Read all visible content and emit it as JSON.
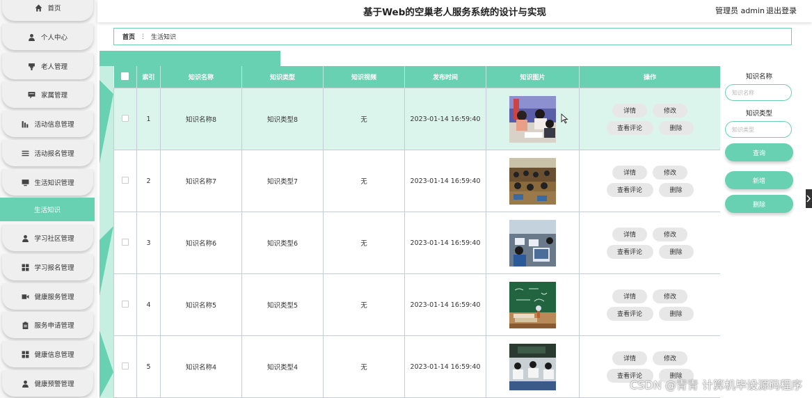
{
  "header": {
    "title": "基于Web的空巢老人服务系统的设计与实现",
    "user": "管理员 admin",
    "logout": "退出登录"
  },
  "breadcrumb": {
    "home": "首页",
    "separator": "⋮",
    "current": "生活知识"
  },
  "sidebar": {
    "items": [
      {
        "label": "首页",
        "icon": "home-icon"
      },
      {
        "label": "个人中心",
        "icon": "person-icon"
      },
      {
        "label": "老人管理",
        "icon": "elder-icon"
      },
      {
        "label": "家属管理",
        "icon": "family-icon"
      },
      {
        "label": "活动信息管理",
        "icon": "chart-icon"
      },
      {
        "label": "活动报名管理",
        "icon": "list-icon"
      },
      {
        "label": "生活知识管理",
        "icon": "monitor-icon"
      },
      {
        "label": "生活知识",
        "icon": "",
        "active": true
      },
      {
        "label": "学习社区管理",
        "icon": "person-icon"
      },
      {
        "label": "学习报名管理",
        "icon": "grid-icon"
      },
      {
        "label": "健康服务管理",
        "icon": "video-icon"
      },
      {
        "label": "服务申请管理",
        "icon": "clipboard-icon"
      },
      {
        "label": "健康信息管理",
        "icon": "grid-icon"
      },
      {
        "label": "健康预警管理",
        "icon": "person-icon"
      }
    ]
  },
  "table": {
    "headers": [
      "索引",
      "知识名称",
      "知识类型",
      "知识视频",
      "发布时间",
      "知识图片",
      "操作"
    ],
    "rows": [
      {
        "index": "1",
        "name": "知识名称8",
        "type": "知识类型8",
        "video": "无",
        "time": "2023-01-14 16:59:40",
        "image": "classroom-photo"
      },
      {
        "index": "2",
        "name": "知识名称7",
        "type": "知识类型7",
        "video": "无",
        "time": "2023-01-14 16:59:40",
        "image": "classroom-photo"
      },
      {
        "index": "3",
        "name": "知识名称6",
        "type": "知识类型6",
        "video": "无",
        "time": "2023-01-14 16:59:40",
        "image": "classroom-photo"
      },
      {
        "index": "4",
        "name": "知识名称5",
        "type": "知识类型5",
        "video": "无",
        "time": "2023-01-14 16:59:40",
        "image": "chalkboard-photo"
      },
      {
        "index": "5",
        "name": "知识名称4",
        "type": "知识类型4",
        "video": "无",
        "time": "2023-01-14 16:59:40",
        "image": "classroom-photo"
      }
    ],
    "actions": {
      "detail": "详情",
      "edit": "修改",
      "comments": "查看评论",
      "delete": "删除"
    }
  },
  "search": {
    "name_label": "知识名称",
    "name_placeholder": "知识名称",
    "type_label": "知识类型",
    "type_placeholder": "知识类型",
    "query": "查询",
    "add": "新增",
    "delete": "删除"
  },
  "watermark": "CSDN @青青  计算机毕设源码程序",
  "colors": {
    "accent": "#68d1b1",
    "highlight_row": "#dcf5ec"
  }
}
